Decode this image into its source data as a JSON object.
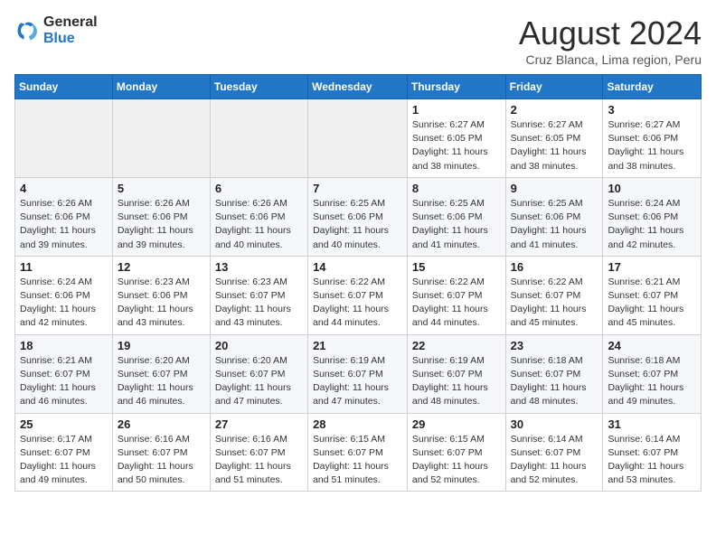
{
  "logo": {
    "line1": "General",
    "line2": "Blue"
  },
  "title": "August 2024",
  "location": "Cruz Blanca, Lima region, Peru",
  "days_of_week": [
    "Sunday",
    "Monday",
    "Tuesday",
    "Wednesday",
    "Thursday",
    "Friday",
    "Saturday"
  ],
  "weeks": [
    [
      {
        "day": "",
        "detail": ""
      },
      {
        "day": "",
        "detail": ""
      },
      {
        "day": "",
        "detail": ""
      },
      {
        "day": "",
        "detail": ""
      },
      {
        "day": "1",
        "detail": "Sunrise: 6:27 AM\nSunset: 6:05 PM\nDaylight: 11 hours\nand 38 minutes."
      },
      {
        "day": "2",
        "detail": "Sunrise: 6:27 AM\nSunset: 6:05 PM\nDaylight: 11 hours\nand 38 minutes."
      },
      {
        "day": "3",
        "detail": "Sunrise: 6:27 AM\nSunset: 6:06 PM\nDaylight: 11 hours\nand 38 minutes."
      }
    ],
    [
      {
        "day": "4",
        "detail": "Sunrise: 6:26 AM\nSunset: 6:06 PM\nDaylight: 11 hours\nand 39 minutes."
      },
      {
        "day": "5",
        "detail": "Sunrise: 6:26 AM\nSunset: 6:06 PM\nDaylight: 11 hours\nand 39 minutes."
      },
      {
        "day": "6",
        "detail": "Sunrise: 6:26 AM\nSunset: 6:06 PM\nDaylight: 11 hours\nand 40 minutes."
      },
      {
        "day": "7",
        "detail": "Sunrise: 6:25 AM\nSunset: 6:06 PM\nDaylight: 11 hours\nand 40 minutes."
      },
      {
        "day": "8",
        "detail": "Sunrise: 6:25 AM\nSunset: 6:06 PM\nDaylight: 11 hours\nand 41 minutes."
      },
      {
        "day": "9",
        "detail": "Sunrise: 6:25 AM\nSunset: 6:06 PM\nDaylight: 11 hours\nand 41 minutes."
      },
      {
        "day": "10",
        "detail": "Sunrise: 6:24 AM\nSunset: 6:06 PM\nDaylight: 11 hours\nand 42 minutes."
      }
    ],
    [
      {
        "day": "11",
        "detail": "Sunrise: 6:24 AM\nSunset: 6:06 PM\nDaylight: 11 hours\nand 42 minutes."
      },
      {
        "day": "12",
        "detail": "Sunrise: 6:23 AM\nSunset: 6:06 PM\nDaylight: 11 hours\nand 43 minutes."
      },
      {
        "day": "13",
        "detail": "Sunrise: 6:23 AM\nSunset: 6:07 PM\nDaylight: 11 hours\nand 43 minutes."
      },
      {
        "day": "14",
        "detail": "Sunrise: 6:22 AM\nSunset: 6:07 PM\nDaylight: 11 hours\nand 44 minutes."
      },
      {
        "day": "15",
        "detail": "Sunrise: 6:22 AM\nSunset: 6:07 PM\nDaylight: 11 hours\nand 44 minutes."
      },
      {
        "day": "16",
        "detail": "Sunrise: 6:22 AM\nSunset: 6:07 PM\nDaylight: 11 hours\nand 45 minutes."
      },
      {
        "day": "17",
        "detail": "Sunrise: 6:21 AM\nSunset: 6:07 PM\nDaylight: 11 hours\nand 45 minutes."
      }
    ],
    [
      {
        "day": "18",
        "detail": "Sunrise: 6:21 AM\nSunset: 6:07 PM\nDaylight: 11 hours\nand 46 minutes."
      },
      {
        "day": "19",
        "detail": "Sunrise: 6:20 AM\nSunset: 6:07 PM\nDaylight: 11 hours\nand 46 minutes."
      },
      {
        "day": "20",
        "detail": "Sunrise: 6:20 AM\nSunset: 6:07 PM\nDaylight: 11 hours\nand 47 minutes."
      },
      {
        "day": "21",
        "detail": "Sunrise: 6:19 AM\nSunset: 6:07 PM\nDaylight: 11 hours\nand 47 minutes."
      },
      {
        "day": "22",
        "detail": "Sunrise: 6:19 AM\nSunset: 6:07 PM\nDaylight: 11 hours\nand 48 minutes."
      },
      {
        "day": "23",
        "detail": "Sunrise: 6:18 AM\nSunset: 6:07 PM\nDaylight: 11 hours\nand 48 minutes."
      },
      {
        "day": "24",
        "detail": "Sunrise: 6:18 AM\nSunset: 6:07 PM\nDaylight: 11 hours\nand 49 minutes."
      }
    ],
    [
      {
        "day": "25",
        "detail": "Sunrise: 6:17 AM\nSunset: 6:07 PM\nDaylight: 11 hours\nand 49 minutes."
      },
      {
        "day": "26",
        "detail": "Sunrise: 6:16 AM\nSunset: 6:07 PM\nDaylight: 11 hours\nand 50 minutes."
      },
      {
        "day": "27",
        "detail": "Sunrise: 6:16 AM\nSunset: 6:07 PM\nDaylight: 11 hours\nand 51 minutes."
      },
      {
        "day": "28",
        "detail": "Sunrise: 6:15 AM\nSunset: 6:07 PM\nDaylight: 11 hours\nand 51 minutes."
      },
      {
        "day": "29",
        "detail": "Sunrise: 6:15 AM\nSunset: 6:07 PM\nDaylight: 11 hours\nand 52 minutes."
      },
      {
        "day": "30",
        "detail": "Sunrise: 6:14 AM\nSunset: 6:07 PM\nDaylight: 11 hours\nand 52 minutes."
      },
      {
        "day": "31",
        "detail": "Sunrise: 6:14 AM\nSunset: 6:07 PM\nDaylight: 11 hours\nand 53 minutes."
      }
    ]
  ]
}
